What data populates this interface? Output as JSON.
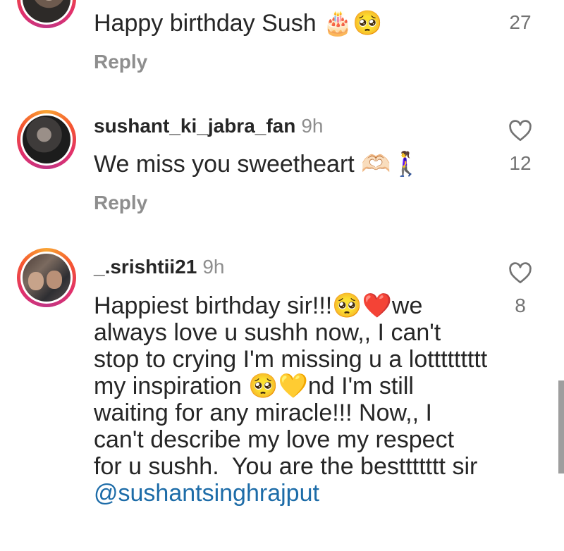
{
  "comments": [
    {
      "text": "Happy birthday Sush 🎂🥺",
      "reply": "Reply",
      "likes": "27"
    },
    {
      "username": "sushant_ki_jabra_fan",
      "time": "9h",
      "text": "We miss you sweetheart 🫶🏻🚶‍♀️",
      "reply": "Reply",
      "likes": "12"
    },
    {
      "username": "_.srishtii21",
      "time": "9h",
      "text": "Happiest birthday sir!!!🥺❤️we always love u sushh now,, I can't stop to crying I'm missing u a lottttttttt my inspiration 🥺💛nd I'm still waiting for any miracle!!! Now,, I can't describe my love my respect for u sushh.  You are the besttttttt sir ",
      "mention": "@sushantsinghrajput",
      "likes": "8"
    }
  ],
  "icons": {
    "like": "heart-outline-icon",
    "avatar": "avatar"
  },
  "colors": {
    "mention": "#1d6ca8",
    "secondary_text": "#8e8e8e",
    "story_ring": "#e1306c"
  }
}
